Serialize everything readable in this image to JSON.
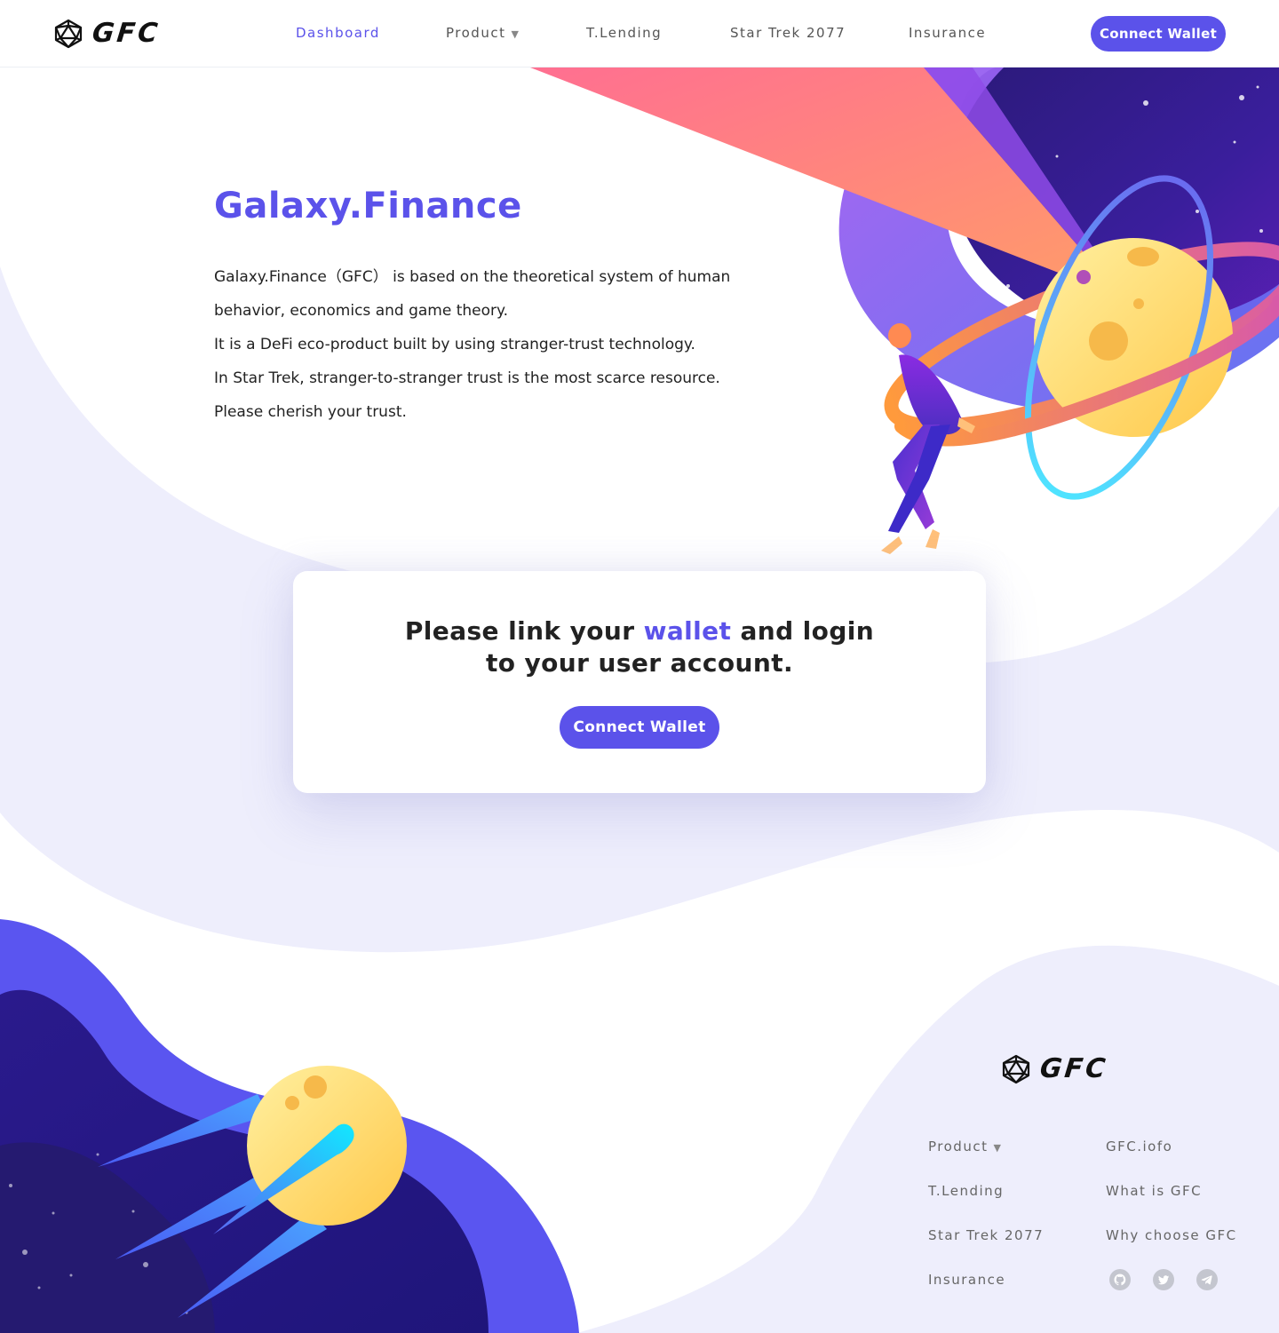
{
  "brand": {
    "name": "GFC",
    "accent_color": "#5b52ea"
  },
  "nav": {
    "items": [
      {
        "label": "Dashboard",
        "active": true
      },
      {
        "label": "Product",
        "has_dropdown": true
      },
      {
        "label": "T.Lending"
      },
      {
        "label": "Star Trek 2077"
      },
      {
        "label": "Insurance"
      }
    ],
    "dropdown_caret": "▼",
    "connect_wallet_label": "Connect Wallet"
  },
  "hero": {
    "title": "Galaxy.Finance",
    "paragraphs": [
      "Galaxy.Finance（GFC） is based on the theoretical system of human",
      "behavior, economics and game theory.",
      "It is a DeFi eco-product built by using stranger-trust technology.",
      "In Star Trek, stranger-to-stranger trust is the most scarce resource.",
      "Please cherish your trust."
    ]
  },
  "login_card": {
    "heading_before": "Please link your ",
    "heading_accent": "wallet",
    "heading_after": " and login to your user account.",
    "button_label": "Connect Wallet"
  },
  "footer": {
    "brand": "GFC",
    "links_left": [
      "Product",
      "T.Lending",
      "Star Trek 2077",
      "Insurance"
    ],
    "product_caret": "▼",
    "links_right": [
      "GFC.iofo",
      "What is GFC",
      "Why choose GFC"
    ],
    "social_icons": [
      "github-icon",
      "twitter-icon",
      "telegram-icon"
    ]
  }
}
